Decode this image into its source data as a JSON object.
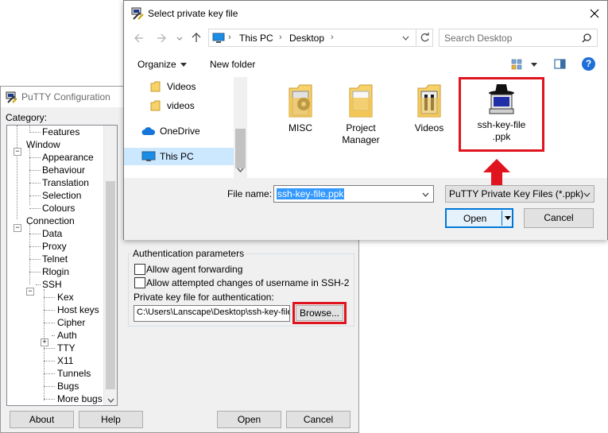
{
  "putty": {
    "title": "PuTTY Configuration",
    "category_label": "Category:",
    "tree": [
      {
        "label": "Features",
        "level": 2
      },
      {
        "label": "Window",
        "level": 0,
        "expanded": true
      },
      {
        "label": "Appearance",
        "level": 1
      },
      {
        "label": "Behaviour",
        "level": 1
      },
      {
        "label": "Translation",
        "level": 1
      },
      {
        "label": "Selection",
        "level": 1
      },
      {
        "label": "Colours",
        "level": 1
      },
      {
        "label": "Connection",
        "level": 0,
        "expanded": true
      },
      {
        "label": "Data",
        "level": 1
      },
      {
        "label": "Proxy",
        "level": 1
      },
      {
        "label": "Telnet",
        "level": 1
      },
      {
        "label": "Rlogin",
        "level": 1
      },
      {
        "label": "SSH",
        "level": 1,
        "expanded": true
      },
      {
        "label": "Kex",
        "level": 2
      },
      {
        "label": "Host keys",
        "level": 2
      },
      {
        "label": "Cipher",
        "level": 2
      },
      {
        "label": "Auth",
        "level": 2,
        "collapsed": true
      },
      {
        "label": "TTY",
        "level": 2
      },
      {
        "label": "X11",
        "level": 2
      },
      {
        "label": "Tunnels",
        "level": 2
      },
      {
        "label": "Bugs",
        "level": 2
      },
      {
        "label": "More bugs",
        "level": 2
      }
    ],
    "auth_group_label": "Authentication parameters",
    "agent_forwarding_label": "Allow agent forwarding",
    "username_changes_label": "Allow attempted changes of username in SSH-2",
    "key_file_label": "Private key file for authentication:",
    "key_file_value": "C:\\Users\\Lanscape\\Desktop\\ssh-key-file",
    "browse_label": "Browse...",
    "about_label": "About",
    "help_label": "Help",
    "open_label": "Open",
    "cancel_label": "Cancel"
  },
  "dialog": {
    "title": "Select private key file",
    "breadcrumb": [
      "This PC",
      "Desktop"
    ],
    "search_placeholder": "Search Desktop",
    "organize_label": "Organize",
    "new_folder_label": "New folder",
    "help_glyph": "?",
    "nav_items": [
      {
        "label": "Videos",
        "icon": "folder-icon"
      },
      {
        "label": "videos",
        "icon": "folder-icon"
      },
      {
        "label": "OneDrive",
        "icon": "cloud-icon"
      },
      {
        "label": "This PC",
        "icon": "computer-icon",
        "selected": true
      }
    ],
    "files": [
      {
        "label": "MISC",
        "icon": "folder-icon"
      },
      {
        "label": "Project Manager",
        "icon": "folder-icon"
      },
      {
        "label": "Videos",
        "icon": "folder-icon"
      },
      {
        "label": "ssh-key-file .ppk",
        "icon": "putty-key-icon",
        "highlighted": true
      }
    ],
    "file_name_label": "File name:",
    "file_name_value": "ssh-key-file.ppk",
    "file_type_value": "PuTTY Private Key Files (*.ppk)",
    "open_label": "Open",
    "cancel_label": "Cancel"
  },
  "colors": {
    "highlight_red": "#e0141e",
    "selection_blue": "#3399ff",
    "nav_selected": "#cce8ff",
    "folder_yellow": "#f7d26b",
    "help_blue": "#1e6fd9"
  }
}
